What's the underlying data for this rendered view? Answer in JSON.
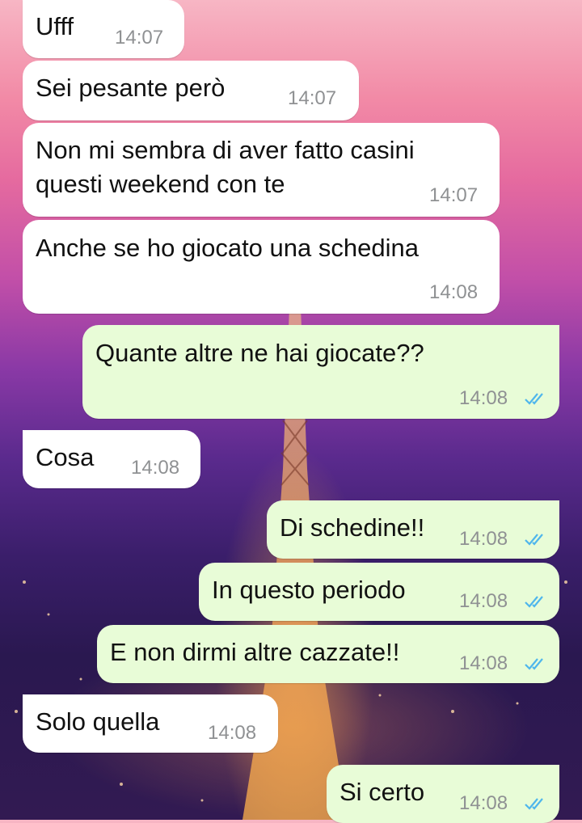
{
  "chat": {
    "messages": [
      {
        "dir": "in",
        "text": "Ufff",
        "time": "14:07"
      },
      {
        "dir": "in",
        "text": "Sei pesante però",
        "time": "14:07"
      },
      {
        "dir": "in",
        "text": "Non mi sembra di aver fatto casini\nquesti weekend con te",
        "time": "14:07"
      },
      {
        "dir": "in",
        "text": "Anche se ho giocato una schedina",
        "time": "14:08"
      },
      {
        "dir": "out",
        "text": "Quante altre ne hai giocate??",
        "time": "14:08",
        "status": "read"
      },
      {
        "dir": "in",
        "text": "Cosa",
        "time": "14:08"
      },
      {
        "dir": "out",
        "text": "Di schedine!!",
        "time": "14:08",
        "status": "read"
      },
      {
        "dir": "out",
        "text": "In questo periodo",
        "time": "14:08",
        "status": "read"
      },
      {
        "dir": "out",
        "text": "E non dirmi altre cazzate!!",
        "time": "14:08",
        "status": "read"
      },
      {
        "dir": "in",
        "text": "Solo quella",
        "time": "14:08"
      },
      {
        "dir": "out",
        "text": "Si certo",
        "time": "14:08",
        "status": "read"
      }
    ]
  },
  "colors": {
    "incoming_bubble": "#ffffff",
    "outgoing_bubble": "#e8fcd7",
    "read_tick": "#4fb6ec",
    "timestamp": "#8f9193"
  },
  "icons": {
    "read_receipt": "double-check-icon"
  }
}
